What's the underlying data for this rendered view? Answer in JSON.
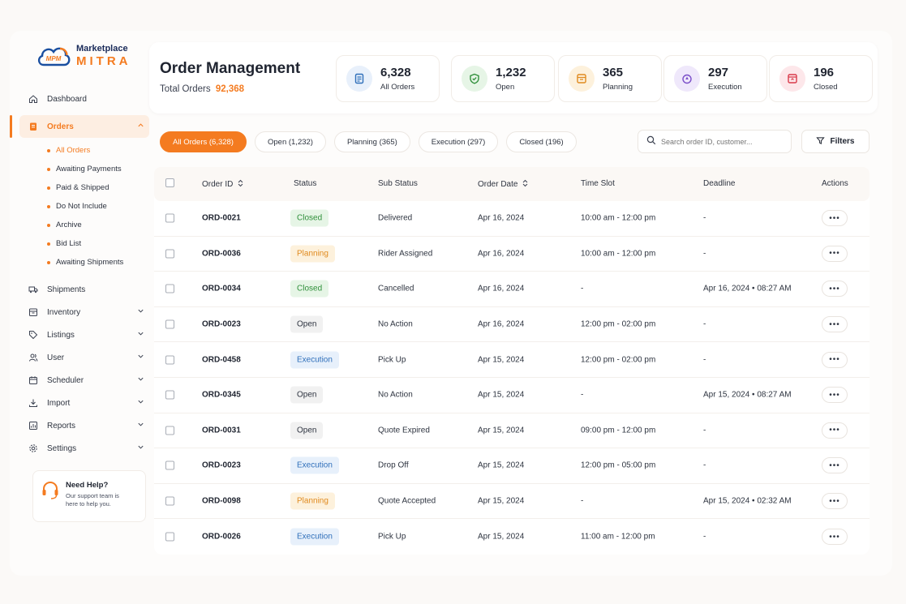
{
  "brand": {
    "line1": "Marketplace",
    "line2": "MITRA",
    "mark": "MPM"
  },
  "sidebar": {
    "items": [
      {
        "label": "Dashboard",
        "icon": "home-icon"
      },
      {
        "label": "Orders",
        "icon": "clipboard-icon"
      },
      {
        "label": "Shipments",
        "icon": "truck-icon"
      },
      {
        "label": "Inventory",
        "icon": "box-icon"
      },
      {
        "label": "Listings",
        "icon": "tag-icon"
      },
      {
        "label": "User",
        "icon": "users-icon"
      },
      {
        "label": "Scheduler",
        "icon": "calendar-icon"
      },
      {
        "label": "Import",
        "icon": "download-icon"
      },
      {
        "label": "Reports",
        "icon": "chart-icon"
      },
      {
        "label": "Settings",
        "icon": "gear-icon"
      }
    ],
    "orders_sub": [
      "All Orders",
      "Awaiting Payments",
      "Paid & Shipped",
      "Do Not Include",
      "Archive",
      "Bid List",
      "Awaiting Shipments"
    ],
    "help": {
      "title": "Need Help?",
      "desc_line1": "Our support team is",
      "desc_line2": "here to help you."
    }
  },
  "header": {
    "title": "Order Management",
    "total_label": "Total Orders",
    "total_value": "92,368"
  },
  "stats": [
    {
      "value": "6,328",
      "label": "All Orders",
      "color": "#2f6fba",
      "bg": "#e8f0fb"
    },
    {
      "value": "1,232",
      "label": "Open",
      "color": "#2f8f3a",
      "bg": "#e6f5e6"
    },
    {
      "value": "365",
      "label": "Planning",
      "color": "#e08a1e",
      "bg": "#fdf1dc"
    },
    {
      "value": "297",
      "label": "Execution",
      "color": "#7b4fc9",
      "bg": "#efe8fb"
    },
    {
      "value": "196",
      "label": "Closed",
      "color": "#d93a4a",
      "bg": "#fde7ea"
    }
  ],
  "tabs": [
    "All Orders (6,328)",
    "Open (1,232)",
    "Planning (365)",
    "Execution (297)",
    "Closed (196)"
  ],
  "search": {
    "placeholder": "Search order ID, customer..."
  },
  "filters_label": "Filters",
  "columns": [
    "Order ID",
    "Status",
    "Sub Status",
    "Order Date",
    "Time Slot",
    "Deadline",
    "Actions"
  ],
  "rows": [
    {
      "id": "ORD-0021",
      "status": "Closed",
      "sub": "Delivered",
      "date": "Apr 16, 2024",
      "slot": "10:00 am - 12:00 pm",
      "deadline": "-"
    },
    {
      "id": "ORD-0036",
      "status": "Planning",
      "sub": "Rider Assigned",
      "date": "Apr 16, 2024",
      "slot": "10:00 am - 12:00 pm",
      "deadline": "-"
    },
    {
      "id": "ORD-0034",
      "status": "Closed",
      "sub": "Cancelled",
      "date": "Apr 16, 2024",
      "slot": "-",
      "deadline": "Apr 16, 2024 • 08:27 AM"
    },
    {
      "id": "ORD-0023",
      "status": "Open",
      "sub": "No Action",
      "date": "Apr 16, 2024",
      "slot": "12:00 pm - 02:00 pm",
      "deadline": "-"
    },
    {
      "id": "ORD-0458",
      "status": "Execution",
      "sub": "Pick Up",
      "date": "Apr 15, 2024",
      "slot": "12:00 pm - 02:00 pm",
      "deadline": "-"
    },
    {
      "id": "ORD-0345",
      "status": "Open",
      "sub": "No Action",
      "date": "Apr 15, 2024",
      "slot": "-",
      "deadline": "Apr 15, 2024 • 08:27 AM"
    },
    {
      "id": "ORD-0031",
      "status": "Open",
      "sub": "Quote Expired",
      "date": "Apr 15, 2024",
      "slot": "09:00 pm - 12:00 pm",
      "deadline": "-"
    },
    {
      "id": "ORD-0023",
      "status": "Execution",
      "sub": "Drop Off",
      "date": "Apr 15, 2024",
      "slot": "12:00 pm - 05:00 pm",
      "deadline": "-"
    },
    {
      "id": "ORD-0098",
      "status": "Planning",
      "sub": "Quote Accepted",
      "date": "Apr 15, 2024",
      "slot": "-",
      "deadline": "Apr 15, 2024 • 02:32 AM"
    },
    {
      "id": "ORD-0026",
      "status": "Execution",
      "sub": "Pick Up",
      "date": "Apr 15, 2024",
      "slot": "11:00 am - 12:00 pm",
      "deadline": "-"
    }
  ],
  "action_glyph": "•••"
}
